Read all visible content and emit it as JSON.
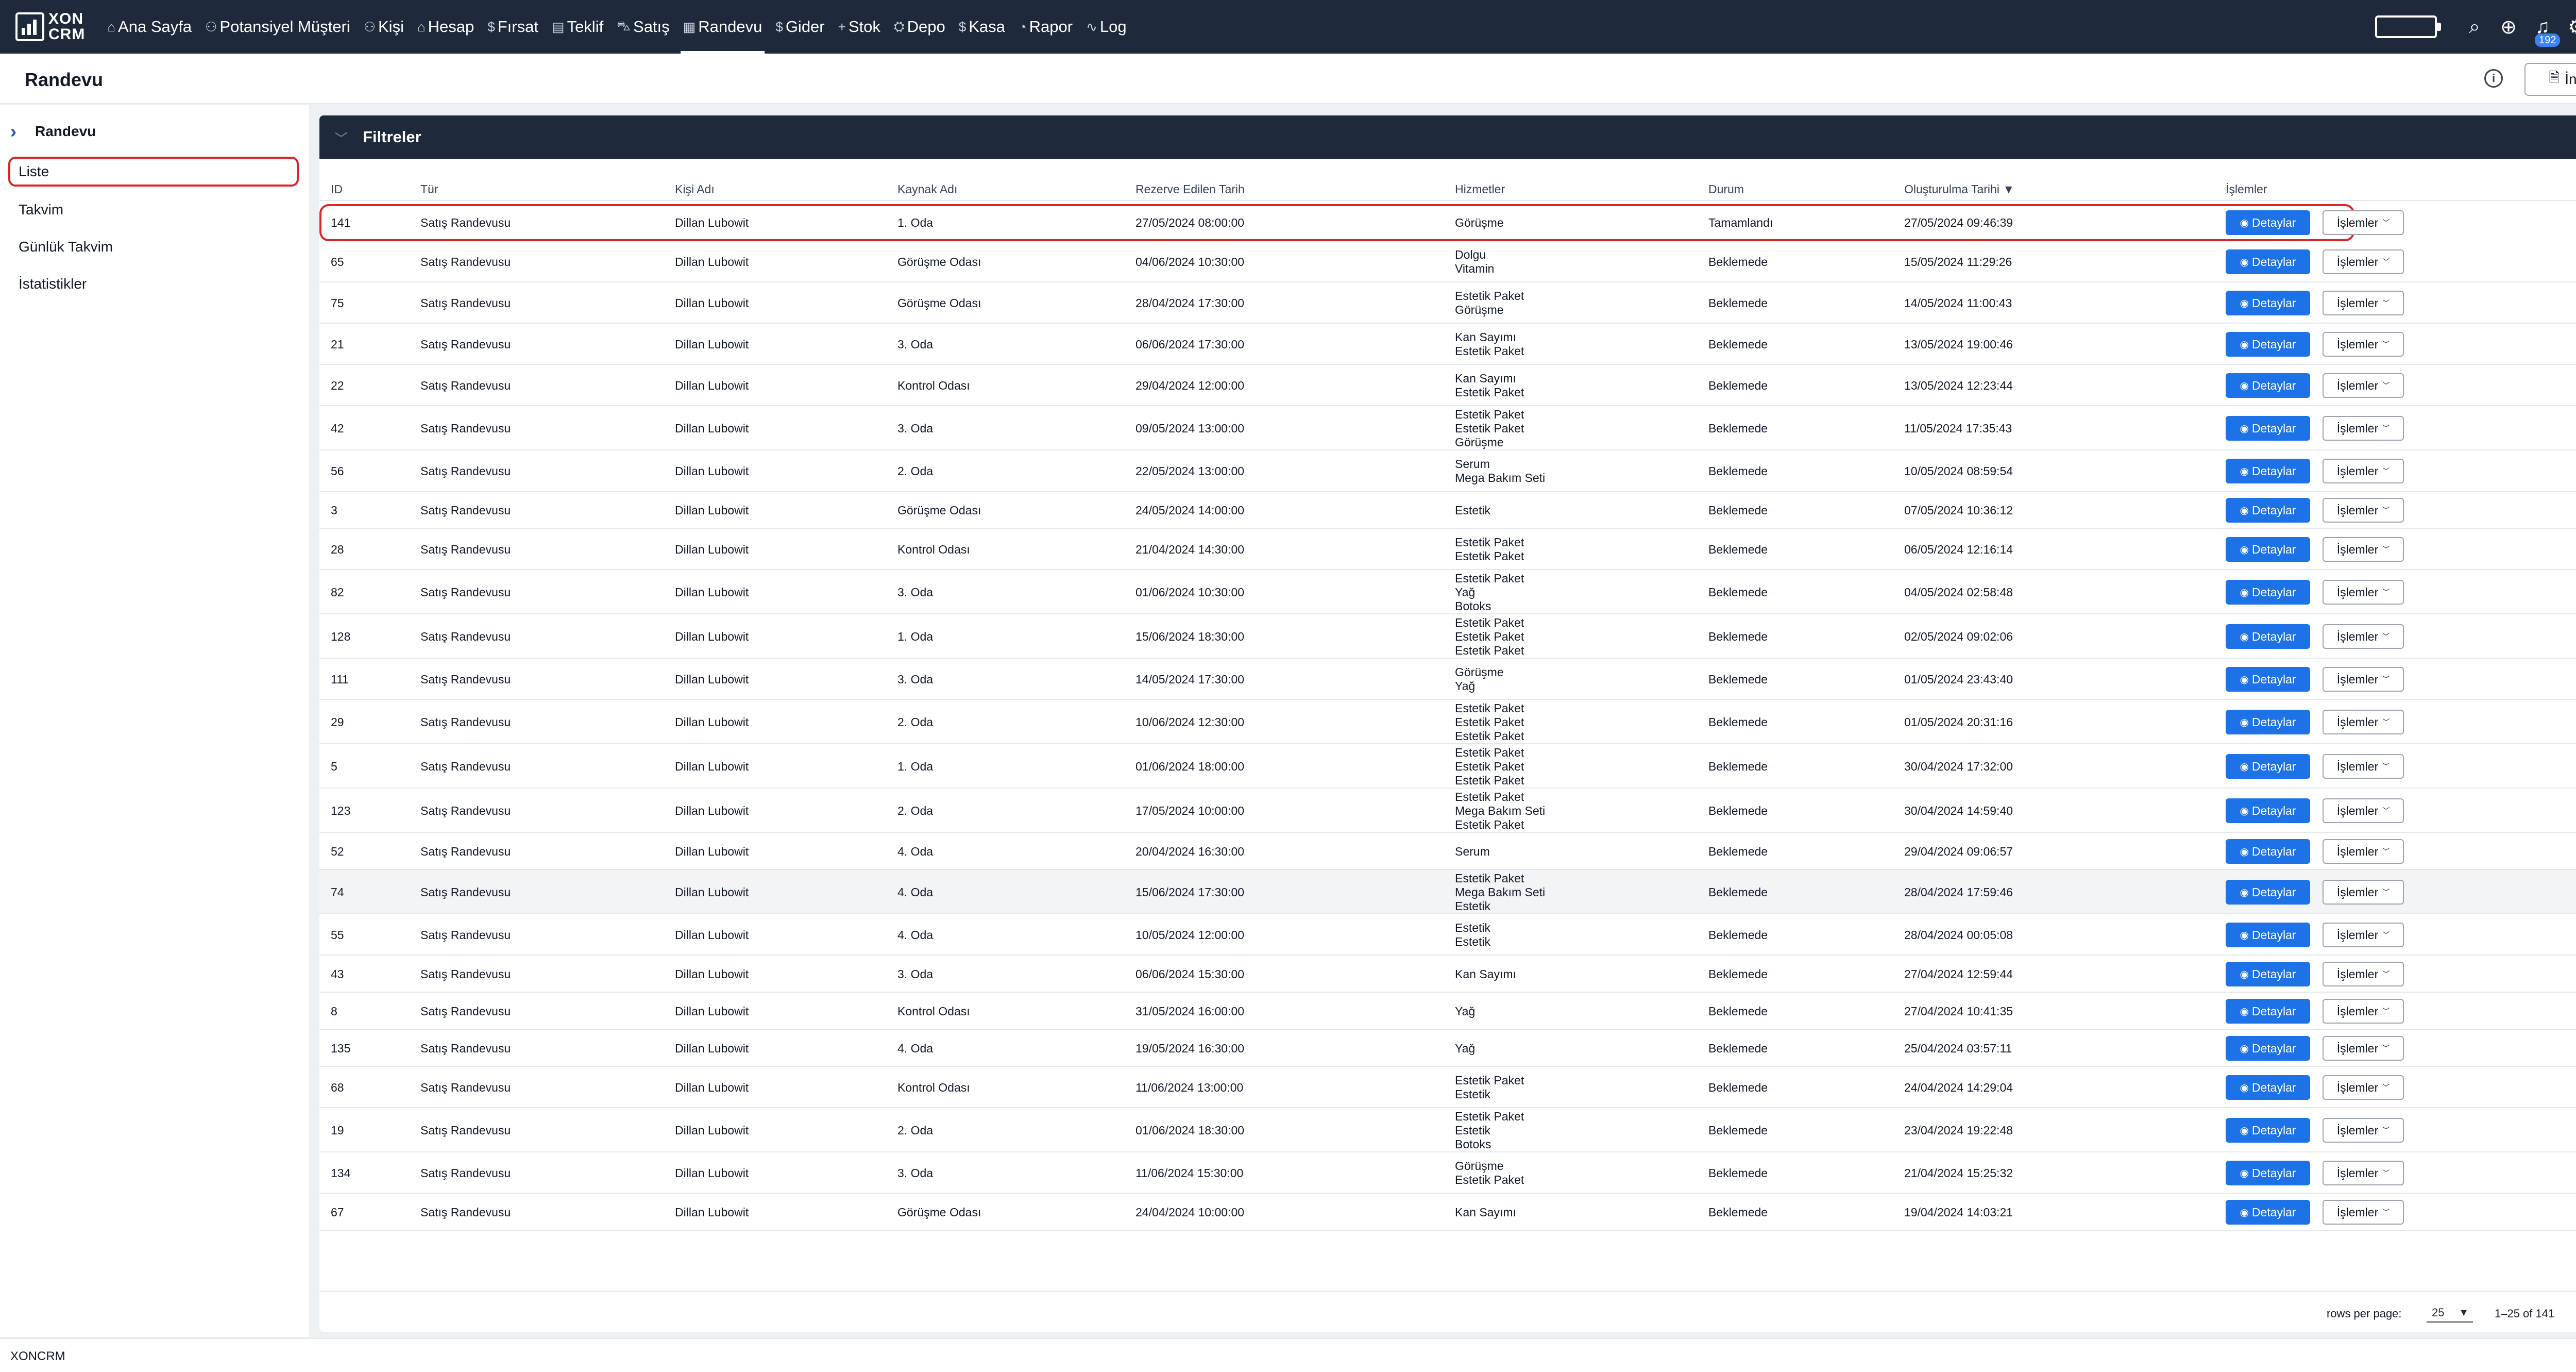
{
  "nav": {
    "logo": "XON CRM",
    "logo_line1": "XON",
    "logo_line2": "CRM",
    "items": [
      {
        "icon": "⌂",
        "label": "Ana Sayfa",
        "name": "home-icon"
      },
      {
        "icon": "⚇",
        "label": "Potansiyel Müşteri",
        "name": "user-icon"
      },
      {
        "icon": "⚇",
        "label": "Kişi",
        "name": "users-icon"
      },
      {
        "icon": "⌂",
        "label": "Hesap",
        "name": "building-icon"
      },
      {
        "icon": "$",
        "label": "Fırsat",
        "name": "dollar-icon"
      },
      {
        "icon": "▤",
        "label": "Teklif",
        "name": "document-icon"
      },
      {
        "icon": "⛍",
        "label": "Satış",
        "name": "cart-icon"
      },
      {
        "icon": "▦",
        "label": "Randevu",
        "name": "calendar-icon"
      },
      {
        "icon": "$",
        "label": "Gider",
        "name": "dollar-icon"
      },
      {
        "icon": "+",
        "label": "Stok",
        "name": "plus-icon"
      },
      {
        "icon": "⛭",
        "label": "Depo",
        "name": "box-icon"
      },
      {
        "icon": "$",
        "label": "Kasa",
        "name": "dollar-icon"
      },
      {
        "icon": "◔",
        "label": "Rapor",
        "name": "chart-icon"
      },
      {
        "icon": "∿",
        "label": "Log",
        "name": "activity-icon"
      }
    ],
    "active": "Randevu",
    "notification_count": "192"
  },
  "page": {
    "title": "Randevu",
    "download_label": "İndir"
  },
  "sidebar": {
    "header": "Randevu",
    "items": [
      {
        "label": "Liste",
        "active": true
      },
      {
        "label": "Takvim",
        "active": false
      },
      {
        "label": "Günlük Takvim",
        "active": false
      },
      {
        "label": "İstatistikler",
        "active": false
      }
    ]
  },
  "filters": {
    "label": "Filtreler"
  },
  "table": {
    "columns": [
      "ID",
      "Tür",
      "Kişi Adı",
      "Kaynak Adı",
      "Rezerve Edilen Tarih",
      "Hizmetler",
      "Durum",
      "Oluşturulma Tarihi",
      "İşlemler"
    ],
    "sort_indicator": "▼",
    "detail_label": "Detaylar",
    "actions_label": "İşlemler",
    "rows": [
      {
        "id": "141",
        "type": "Satış Randevusu",
        "person": "Dillan Lubowit",
        "resource": "1. Oda",
        "reserved": "27/05/2024 08:00:00",
        "services": [
          "Görüşme"
        ],
        "status": "Tamamlandı",
        "created": "27/05/2024 09:46:39"
      },
      {
        "id": "65",
        "type": "Satış Randevusu",
        "person": "Dillan Lubowit",
        "resource": "Görüşme Odası",
        "reserved": "04/06/2024 10:30:00",
        "services": [
          "Dolgu",
          "Vitamin"
        ],
        "status": "Beklemede",
        "created": "15/05/2024 11:29:26"
      },
      {
        "id": "75",
        "type": "Satış Randevusu",
        "person": "Dillan Lubowit",
        "resource": "Görüşme Odası",
        "reserved": "28/04/2024 17:30:00",
        "services": [
          "Estetik Paket",
          "Görüşme"
        ],
        "status": "Beklemede",
        "created": "14/05/2024 11:00:43"
      },
      {
        "id": "21",
        "type": "Satış Randevusu",
        "person": "Dillan Lubowit",
        "resource": "3. Oda",
        "reserved": "06/06/2024 17:30:00",
        "services": [
          "Kan Sayımı",
          "Estetik Paket"
        ],
        "status": "Beklemede",
        "created": "13/05/2024 19:00:46"
      },
      {
        "id": "22",
        "type": "Satış Randevusu",
        "person": "Dillan Lubowit",
        "resource": "Kontrol Odası",
        "reserved": "29/04/2024 12:00:00",
        "services": [
          "Kan Sayımı",
          "Estetik Paket"
        ],
        "status": "Beklemede",
        "created": "13/05/2024 12:23:44"
      },
      {
        "id": "42",
        "type": "Satış Randevusu",
        "person": "Dillan Lubowit",
        "resource": "3. Oda",
        "reserved": "09/05/2024 13:00:00",
        "services": [
          "Estetik Paket",
          "Estetik Paket",
          "Görüşme"
        ],
        "status": "Beklemede",
        "created": "11/05/2024 17:35:43"
      },
      {
        "id": "56",
        "type": "Satış Randevusu",
        "person": "Dillan Lubowit",
        "resource": "2. Oda",
        "reserved": "22/05/2024 13:00:00",
        "services": [
          "Serum",
          "Mega Bakım Seti"
        ],
        "status": "Beklemede",
        "created": "10/05/2024 08:59:54"
      },
      {
        "id": "3",
        "type": "Satış Randevusu",
        "person": "Dillan Lubowit",
        "resource": "Görüşme Odası",
        "reserved": "24/05/2024 14:00:00",
        "services": [
          "Estetik"
        ],
        "status": "Beklemede",
        "created": "07/05/2024 10:36:12"
      },
      {
        "id": "28",
        "type": "Satış Randevusu",
        "person": "Dillan Lubowit",
        "resource": "Kontrol Odası",
        "reserved": "21/04/2024 14:30:00",
        "services": [
          "Estetik Paket",
          "Estetik Paket"
        ],
        "status": "Beklemede",
        "created": "06/05/2024 12:16:14"
      },
      {
        "id": "82",
        "type": "Satış Randevusu",
        "person": "Dillan Lubowit",
        "resource": "3. Oda",
        "reserved": "01/06/2024 10:30:00",
        "services": [
          "Estetik Paket",
          "Yağ",
          "Botoks"
        ],
        "status": "Beklemede",
        "created": "04/05/2024 02:58:48"
      },
      {
        "id": "128",
        "type": "Satış Randevusu",
        "person": "Dillan Lubowit",
        "resource": "1. Oda",
        "reserved": "15/06/2024 18:30:00",
        "services": [
          "Estetik Paket",
          "Estetik Paket",
          "Estetik Paket"
        ],
        "status": "Beklemede",
        "created": "02/05/2024 09:02:06"
      },
      {
        "id": "111",
        "type": "Satış Randevusu",
        "person": "Dillan Lubowit",
        "resource": "3. Oda",
        "reserved": "14/05/2024 17:30:00",
        "services": [
          "Görüşme",
          "Yağ"
        ],
        "status": "Beklemede",
        "created": "01/05/2024 23:43:40"
      },
      {
        "id": "29",
        "type": "Satış Randevusu",
        "person": "Dillan Lubowit",
        "resource": "2. Oda",
        "reserved": "10/06/2024 12:30:00",
        "services": [
          "Estetik Paket",
          "Estetik Paket",
          "Estetik Paket"
        ],
        "status": "Beklemede",
        "created": "01/05/2024 20:31:16"
      },
      {
        "id": "5",
        "type": "Satış Randevusu",
        "person": "Dillan Lubowit",
        "resource": "1. Oda",
        "reserved": "01/06/2024 18:00:00",
        "services": [
          "Estetik Paket",
          "Estetik Paket",
          "Estetik Paket"
        ],
        "status": "Beklemede",
        "created": "30/04/2024 17:32:00"
      },
      {
        "id": "123",
        "type": "Satış Randevusu",
        "person": "Dillan Lubowit",
        "resource": "2. Oda",
        "reserved": "17/05/2024 10:00:00",
        "services": [
          "Estetik Paket",
          "Mega Bakım Seti",
          "Estetik Paket"
        ],
        "status": "Beklemede",
        "created": "30/04/2024 14:59:40"
      },
      {
        "id": "52",
        "type": "Satış Randevusu",
        "person": "Dillan Lubowit",
        "resource": "4. Oda",
        "reserved": "20/04/2024 16:30:00",
        "services": [
          "Serum"
        ],
        "status": "Beklemede",
        "created": "29/04/2024 09:06:57"
      },
      {
        "id": "74",
        "type": "Satış Randevusu",
        "person": "Dillan Lubowit",
        "resource": "4. Oda",
        "reserved": "15/06/2024 17:30:00",
        "services": [
          "Estetik Paket",
          "Mega Bakım Seti",
          "Estetik"
        ],
        "status": "Beklemede",
        "created": "28/04/2024 17:59:46"
      },
      {
        "id": "55",
        "type": "Satış Randevusu",
        "person": "Dillan Lubowit",
        "resource": "4. Oda",
        "reserved": "10/05/2024 12:00:00",
        "services": [
          "Estetik",
          "Estetik"
        ],
        "status": "Beklemede",
        "created": "28/04/2024 00:05:08"
      },
      {
        "id": "43",
        "type": "Satış Randevusu",
        "person": "Dillan Lubowit",
        "resource": "3. Oda",
        "reserved": "06/06/2024 15:30:00",
        "services": [
          "Kan Sayımı"
        ],
        "status": "Beklemede",
        "created": "27/04/2024 12:59:44"
      },
      {
        "id": "8",
        "type": "Satış Randevusu",
        "person": "Dillan Lubowit",
        "resource": "Kontrol Odası",
        "reserved": "31/05/2024 16:00:00",
        "services": [
          "Yağ"
        ],
        "status": "Beklemede",
        "created": "27/04/2024 10:41:35"
      },
      {
        "id": "135",
        "type": "Satış Randevusu",
        "person": "Dillan Lubowit",
        "resource": "4. Oda",
        "reserved": "19/05/2024 16:30:00",
        "services": [
          "Yağ"
        ],
        "status": "Beklemede",
        "created": "25/04/2024 03:57:11"
      },
      {
        "id": "68",
        "type": "Satış Randevusu",
        "person": "Dillan Lubowit",
        "resource": "Kontrol Odası",
        "reserved": "11/06/2024 13:00:00",
        "services": [
          "Estetik Paket",
          "Estetik"
        ],
        "status": "Beklemede",
        "created": "24/04/2024 14:29:04"
      },
      {
        "id": "19",
        "type": "Satış Randevusu",
        "person": "Dillan Lubowit",
        "resource": "2. Oda",
        "reserved": "01/06/2024 18:30:00",
        "services": [
          "Estetik Paket",
          "Estetik",
          "Botoks"
        ],
        "status": "Beklemede",
        "created": "23/04/2024 19:22:48"
      },
      {
        "id": "134",
        "type": "Satış Randevusu",
        "person": "Dillan Lubowit",
        "resource": "3. Oda",
        "reserved": "11/06/2024 15:30:00",
        "services": [
          "Görüşme",
          "Estetik Paket"
        ],
        "status": "Beklemede",
        "created": "21/04/2024 15:25:32"
      },
      {
        "id": "67",
        "type": "Satış Randevusu",
        "person": "Dillan Lubowit",
        "resource": "Görüşme Odası",
        "reserved": "24/04/2024 10:00:00",
        "services": [
          "Kan Sayımı"
        ],
        "status": "Beklemede",
        "created": "19/04/2024 14:03:21"
      }
    ]
  },
  "pagination": {
    "rows_per_page_label": "rows per page:",
    "rows_per_page": "25",
    "range": "1–25 of 141",
    "prev": "‹",
    "next": "›"
  },
  "footer": {
    "text": "XONCRM"
  }
}
